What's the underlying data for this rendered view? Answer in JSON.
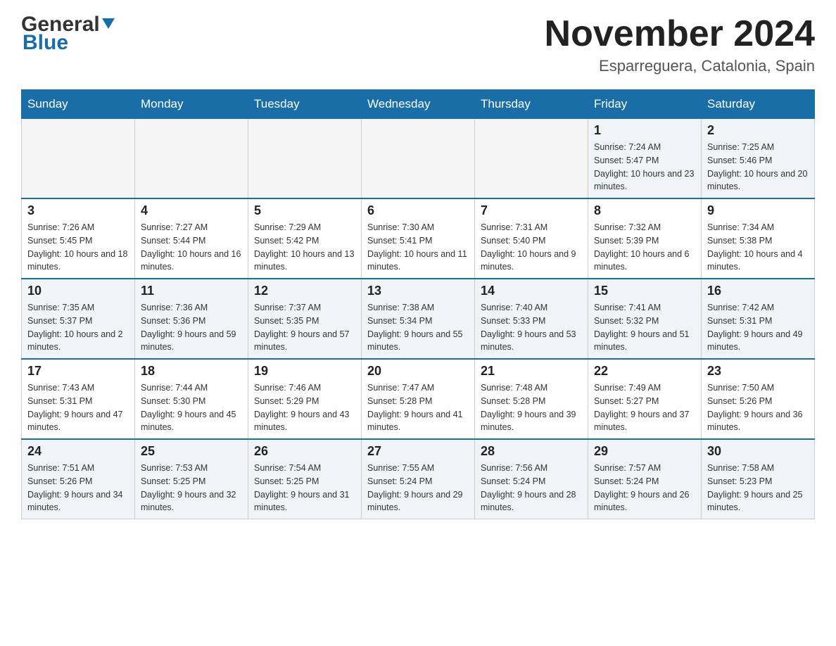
{
  "header": {
    "logo_general": "General",
    "logo_blue": "Blue",
    "month_title": "November 2024",
    "location": "Esparreguera, Catalonia, Spain"
  },
  "days_of_week": [
    "Sunday",
    "Monday",
    "Tuesday",
    "Wednesday",
    "Thursday",
    "Friday",
    "Saturday"
  ],
  "weeks": [
    {
      "days": [
        {
          "date": "",
          "sunrise": "",
          "sunset": "",
          "daylight": ""
        },
        {
          "date": "",
          "sunrise": "",
          "sunset": "",
          "daylight": ""
        },
        {
          "date": "",
          "sunrise": "",
          "sunset": "",
          "daylight": ""
        },
        {
          "date": "",
          "sunrise": "",
          "sunset": "",
          "daylight": ""
        },
        {
          "date": "",
          "sunrise": "",
          "sunset": "",
          "daylight": ""
        },
        {
          "date": "1",
          "sunrise": "Sunrise: 7:24 AM",
          "sunset": "Sunset: 5:47 PM",
          "daylight": "Daylight: 10 hours and 23 minutes."
        },
        {
          "date": "2",
          "sunrise": "Sunrise: 7:25 AM",
          "sunset": "Sunset: 5:46 PM",
          "daylight": "Daylight: 10 hours and 20 minutes."
        }
      ]
    },
    {
      "days": [
        {
          "date": "3",
          "sunrise": "Sunrise: 7:26 AM",
          "sunset": "Sunset: 5:45 PM",
          "daylight": "Daylight: 10 hours and 18 minutes."
        },
        {
          "date": "4",
          "sunrise": "Sunrise: 7:27 AM",
          "sunset": "Sunset: 5:44 PM",
          "daylight": "Daylight: 10 hours and 16 minutes."
        },
        {
          "date": "5",
          "sunrise": "Sunrise: 7:29 AM",
          "sunset": "Sunset: 5:42 PM",
          "daylight": "Daylight: 10 hours and 13 minutes."
        },
        {
          "date": "6",
          "sunrise": "Sunrise: 7:30 AM",
          "sunset": "Sunset: 5:41 PM",
          "daylight": "Daylight: 10 hours and 11 minutes."
        },
        {
          "date": "7",
          "sunrise": "Sunrise: 7:31 AM",
          "sunset": "Sunset: 5:40 PM",
          "daylight": "Daylight: 10 hours and 9 minutes."
        },
        {
          "date": "8",
          "sunrise": "Sunrise: 7:32 AM",
          "sunset": "Sunset: 5:39 PM",
          "daylight": "Daylight: 10 hours and 6 minutes."
        },
        {
          "date": "9",
          "sunrise": "Sunrise: 7:34 AM",
          "sunset": "Sunset: 5:38 PM",
          "daylight": "Daylight: 10 hours and 4 minutes."
        }
      ]
    },
    {
      "days": [
        {
          "date": "10",
          "sunrise": "Sunrise: 7:35 AM",
          "sunset": "Sunset: 5:37 PM",
          "daylight": "Daylight: 10 hours and 2 minutes."
        },
        {
          "date": "11",
          "sunrise": "Sunrise: 7:36 AM",
          "sunset": "Sunset: 5:36 PM",
          "daylight": "Daylight: 9 hours and 59 minutes."
        },
        {
          "date": "12",
          "sunrise": "Sunrise: 7:37 AM",
          "sunset": "Sunset: 5:35 PM",
          "daylight": "Daylight: 9 hours and 57 minutes."
        },
        {
          "date": "13",
          "sunrise": "Sunrise: 7:38 AM",
          "sunset": "Sunset: 5:34 PM",
          "daylight": "Daylight: 9 hours and 55 minutes."
        },
        {
          "date": "14",
          "sunrise": "Sunrise: 7:40 AM",
          "sunset": "Sunset: 5:33 PM",
          "daylight": "Daylight: 9 hours and 53 minutes."
        },
        {
          "date": "15",
          "sunrise": "Sunrise: 7:41 AM",
          "sunset": "Sunset: 5:32 PM",
          "daylight": "Daylight: 9 hours and 51 minutes."
        },
        {
          "date": "16",
          "sunrise": "Sunrise: 7:42 AM",
          "sunset": "Sunset: 5:31 PM",
          "daylight": "Daylight: 9 hours and 49 minutes."
        }
      ]
    },
    {
      "days": [
        {
          "date": "17",
          "sunrise": "Sunrise: 7:43 AM",
          "sunset": "Sunset: 5:31 PM",
          "daylight": "Daylight: 9 hours and 47 minutes."
        },
        {
          "date": "18",
          "sunrise": "Sunrise: 7:44 AM",
          "sunset": "Sunset: 5:30 PM",
          "daylight": "Daylight: 9 hours and 45 minutes."
        },
        {
          "date": "19",
          "sunrise": "Sunrise: 7:46 AM",
          "sunset": "Sunset: 5:29 PM",
          "daylight": "Daylight: 9 hours and 43 minutes."
        },
        {
          "date": "20",
          "sunrise": "Sunrise: 7:47 AM",
          "sunset": "Sunset: 5:28 PM",
          "daylight": "Daylight: 9 hours and 41 minutes."
        },
        {
          "date": "21",
          "sunrise": "Sunrise: 7:48 AM",
          "sunset": "Sunset: 5:28 PM",
          "daylight": "Daylight: 9 hours and 39 minutes."
        },
        {
          "date": "22",
          "sunrise": "Sunrise: 7:49 AM",
          "sunset": "Sunset: 5:27 PM",
          "daylight": "Daylight: 9 hours and 37 minutes."
        },
        {
          "date": "23",
          "sunrise": "Sunrise: 7:50 AM",
          "sunset": "Sunset: 5:26 PM",
          "daylight": "Daylight: 9 hours and 36 minutes."
        }
      ]
    },
    {
      "days": [
        {
          "date": "24",
          "sunrise": "Sunrise: 7:51 AM",
          "sunset": "Sunset: 5:26 PM",
          "daylight": "Daylight: 9 hours and 34 minutes."
        },
        {
          "date": "25",
          "sunrise": "Sunrise: 7:53 AM",
          "sunset": "Sunset: 5:25 PM",
          "daylight": "Daylight: 9 hours and 32 minutes."
        },
        {
          "date": "26",
          "sunrise": "Sunrise: 7:54 AM",
          "sunset": "Sunset: 5:25 PM",
          "daylight": "Daylight: 9 hours and 31 minutes."
        },
        {
          "date": "27",
          "sunrise": "Sunrise: 7:55 AM",
          "sunset": "Sunset: 5:24 PM",
          "daylight": "Daylight: 9 hours and 29 minutes."
        },
        {
          "date": "28",
          "sunrise": "Sunrise: 7:56 AM",
          "sunset": "Sunset: 5:24 PM",
          "daylight": "Daylight: 9 hours and 28 minutes."
        },
        {
          "date": "29",
          "sunrise": "Sunrise: 7:57 AM",
          "sunset": "Sunset: 5:24 PM",
          "daylight": "Daylight: 9 hours and 26 minutes."
        },
        {
          "date": "30",
          "sunrise": "Sunrise: 7:58 AM",
          "sunset": "Sunset: 5:23 PM",
          "daylight": "Daylight: 9 hours and 25 minutes."
        }
      ]
    }
  ]
}
